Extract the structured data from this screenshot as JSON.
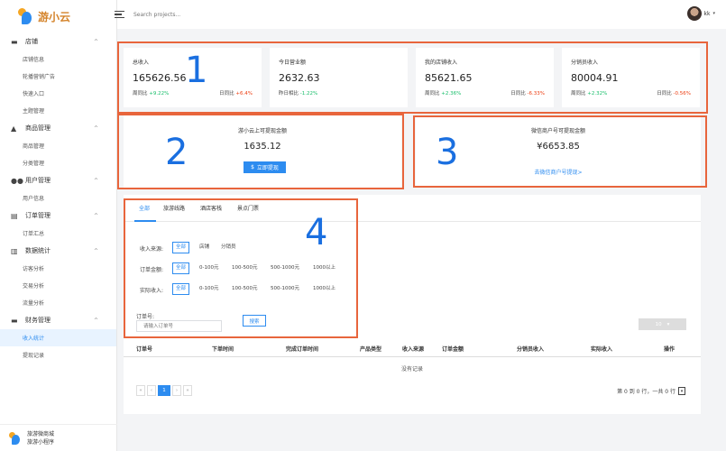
{
  "brand": {
    "name": "游小云"
  },
  "sidebar": {
    "groups": [
      {
        "icon": "store-icon",
        "label": "店铺",
        "items": [
          "店铺信息",
          "轮播营销广告",
          "快速入口",
          "主题管理"
        ]
      },
      {
        "icon": "product-icon",
        "label": "商品管理",
        "items": [
          "商品管理",
          "分类管理"
        ]
      },
      {
        "icon": "users-icon",
        "label": "用户管理",
        "items": [
          "用户信息"
        ]
      },
      {
        "icon": "order-icon",
        "label": "订单管理",
        "items": [
          "订单汇总"
        ]
      },
      {
        "icon": "chart-icon",
        "label": "数据统计",
        "items": [
          "访客分析",
          "交易分析",
          "流量分析"
        ]
      },
      {
        "icon": "wallet-icon",
        "label": "财务管理",
        "items": [
          "收入统计",
          "提现记录"
        ]
      }
    ],
    "active_item": "收入统计",
    "footer": {
      "line1": "旅游微商城",
      "line2": "旅游小程序"
    }
  },
  "header": {
    "search_placeholder": "Search projects...",
    "user": "kk"
  },
  "stats": [
    {
      "title": "总收入",
      "value": "165626.56",
      "left_label": "周同比",
      "left_value": "+9.22%",
      "left_dir": "up",
      "right_label": "日同比",
      "right_value": "+6.4%",
      "right_dir": "down"
    },
    {
      "title": "今日营业额",
      "value": "2632.63",
      "left_label": "昨日相比",
      "left_value": "-1.22%",
      "left_dir": "up",
      "right_label": "",
      "right_value": "",
      "right_dir": ""
    },
    {
      "title": "我的店铺收入",
      "value": "85621.65",
      "left_label": "周同比",
      "left_value": "+2.36%",
      "left_dir": "up",
      "right_label": "日同比",
      "right_value": "-6.33%",
      "right_dir": "down"
    },
    {
      "title": "分销员收入",
      "value": "80004.91",
      "left_label": "周同比",
      "left_value": "+2.32%",
      "left_dir": "up",
      "right_label": "日同比",
      "right_value": "-0.56%",
      "right_dir": "down"
    }
  ],
  "withdraw": {
    "platform": {
      "title": "游小云上可提现金额",
      "value": "1635.12",
      "button": "立即提现"
    },
    "wechat": {
      "title": "微信商户号可提现金额",
      "value": "¥6653.85",
      "link": "去微信商户号提现>"
    }
  },
  "annotations": [
    "1",
    "2",
    "3",
    "4"
  ],
  "orders": {
    "tabs": [
      "全部",
      "旅游线路",
      "酒店客栈",
      "景点门票"
    ],
    "filters": {
      "source": {
        "label": "收入来源:",
        "options": [
          "全部",
          "店铺",
          "分销员"
        ]
      },
      "amount": {
        "label": "订单金额:",
        "options": [
          "全部",
          "0-100元",
          "100-500元",
          "500-1000元",
          "1000以上"
        ]
      },
      "actual": {
        "label": "实际收入:",
        "options": [
          "全部",
          "0-100元",
          "100-500元",
          "500-1000元",
          "1000以上"
        ]
      }
    },
    "order_no_label": "订单号:",
    "order_no_placeholder": "请输入订单号",
    "search_button": "搜索",
    "page_size": "10",
    "columns": [
      "订单号",
      "下单时间",
      "完成订单时间",
      "产品类型",
      "收入来源",
      "订单金额",
      "分销员收入",
      "实际收入",
      "操作"
    ],
    "empty_text": "没有记录",
    "pager": [
      "«",
      "‹",
      "1",
      "›",
      "»"
    ],
    "page_info": "第 0 到 0 行，一共 0 行",
    "page_jump": "▾"
  }
}
